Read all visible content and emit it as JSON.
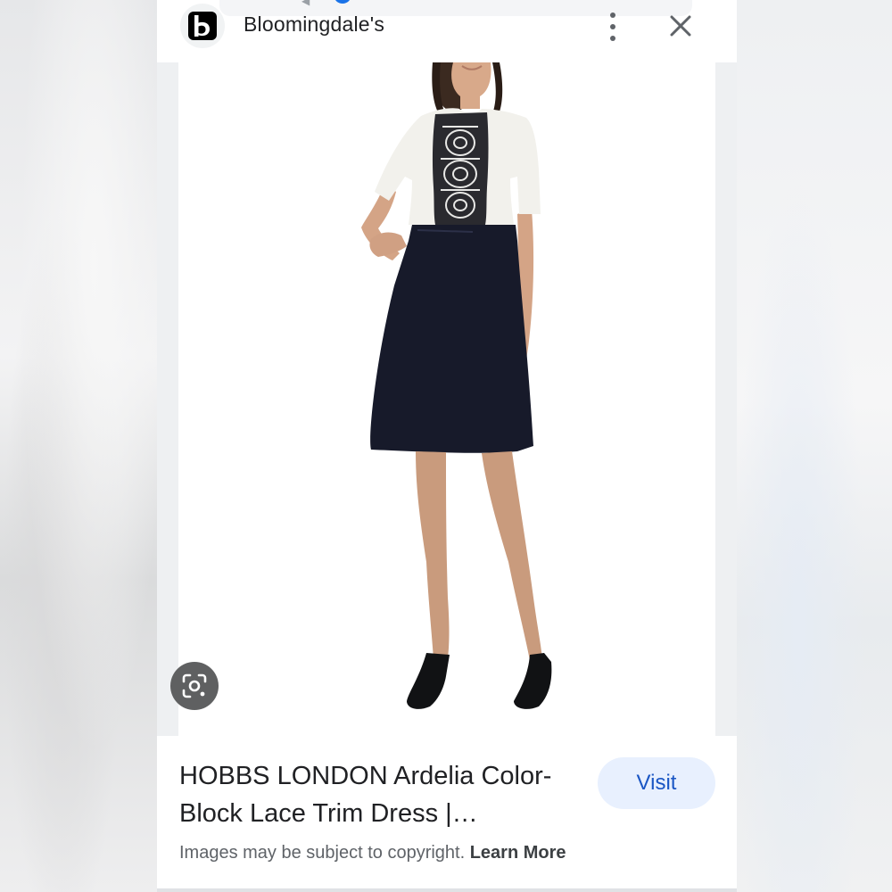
{
  "header": {
    "site_name": "Bloomingdale's",
    "site_logo_letter": "b",
    "more_icon": "more-vert-icon",
    "close_icon": "close-icon"
  },
  "image": {
    "subject": "model-wearing-dress",
    "lens_icon": "google-lens-icon"
  },
  "info": {
    "title": "HOBBS LONDON Ardelia Color-Block Lace Trim Dress |…",
    "visit_label": "Visit",
    "copyright_text": "Images may be subject to copyright. ",
    "learn_more_label": "Learn More"
  },
  "colors": {
    "accent": "#1a56c4",
    "visit_bg": "#e8f0fe",
    "text_primary": "#202124",
    "text_secondary": "#5f6368"
  }
}
